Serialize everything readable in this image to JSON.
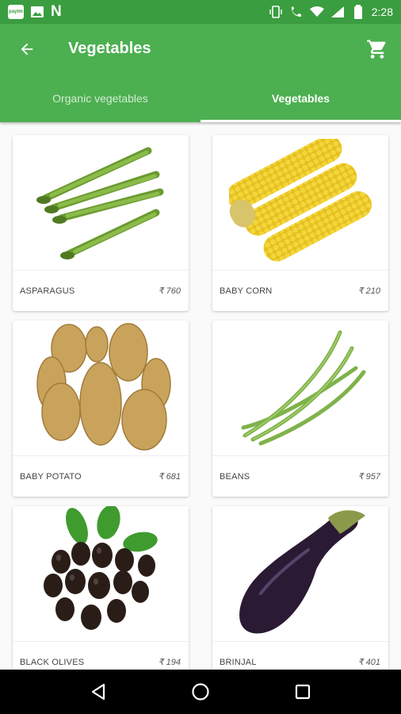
{
  "status_bar": {
    "time": "2:28",
    "left_icons": [
      "paytm-icon",
      "image-icon",
      "n-icon"
    ],
    "right_icons": [
      "vibrate-icon",
      "call-icon",
      "wifi-icon",
      "signal-icon",
      "battery-icon"
    ],
    "paytm_label": "paytm",
    "n_label": "N"
  },
  "app_bar": {
    "title": "Vegetables",
    "color": "#4caf50"
  },
  "tabs": [
    {
      "label": "Organic vegetables",
      "active": false
    },
    {
      "label": "Vegetables",
      "active": true
    }
  ],
  "products": [
    {
      "name": "ASPARAGUS",
      "price": "₹ 760",
      "image": "asparagus"
    },
    {
      "name": "BABY CORN",
      "price": "₹ 210",
      "image": "baby-corn"
    },
    {
      "name": "BABY POTATO",
      "price": "₹ 681",
      "image": "baby-potato"
    },
    {
      "name": "BEANS",
      "price": "₹ 957",
      "image": "beans"
    },
    {
      "name": "BLACK OLIVES",
      "price": "₹ 194",
      "image": "black-olives"
    },
    {
      "name": "BRINJAL",
      "price": "₹ 401",
      "image": "brinjal"
    }
  ]
}
